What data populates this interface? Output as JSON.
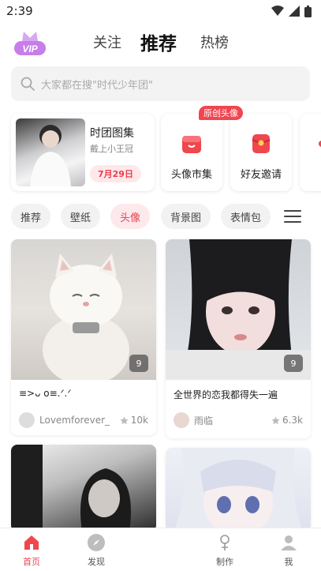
{
  "status": {
    "time": "2:39"
  },
  "top_nav": {
    "vip_label": "VIP",
    "tabs": [
      {
        "label": "关注"
      },
      {
        "label": "推荐"
      },
      {
        "label": "热榜"
      }
    ]
  },
  "search": {
    "placeholder": "大家都在搜\"时代少年团\""
  },
  "album": {
    "title": "时团图集",
    "subtitle": "戴上小王冠",
    "date": "7月29日"
  },
  "tiles": [
    {
      "label": "头像市集",
      "badge": "原创头像",
      "icon": "shop-icon"
    },
    {
      "label": "好友邀请",
      "icon": "red-packet-icon"
    }
  ],
  "chips": [
    {
      "label": "推荐"
    },
    {
      "label": "壁纸"
    },
    {
      "label": "头像"
    },
    {
      "label": "背景图"
    },
    {
      "label": "表情包"
    }
  ],
  "feed": [
    {
      "caption": "≡>ᴗ o≡.ᐟ.ᐟ",
      "user": "Lovemforever_",
      "likes": "10k",
      "count": "9"
    },
    {
      "caption": "全世界的恋我都得失一遍",
      "user": "雨临",
      "likes": "6.3k",
      "count": "9"
    },
    {
      "caption": "",
      "user": "",
      "likes": "",
      "count": ""
    },
    {
      "caption": "",
      "user": "",
      "likes": "",
      "count": ""
    }
  ],
  "bottom_nav": [
    {
      "label": "首页",
      "icon": "home-icon"
    },
    {
      "label": "发现",
      "icon": "compass-icon"
    },
    {
      "label": "制作",
      "icon": "create-icon"
    },
    {
      "label": "我",
      "icon": "profile-icon"
    }
  ],
  "colors": {
    "accent": "#f0464f",
    "chip_active_bg": "#fde9eb"
  }
}
